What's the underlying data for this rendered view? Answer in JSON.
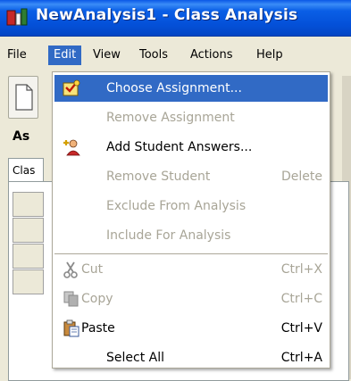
{
  "window": {
    "title": "NewAnalysis1 - Class Analysis"
  },
  "menubar": {
    "items": [
      {
        "label": "File"
      },
      {
        "label": "Edit"
      },
      {
        "label": "View"
      },
      {
        "label": "Tools"
      },
      {
        "label": "Actions"
      },
      {
        "label": "Help"
      }
    ]
  },
  "background": {
    "section_label": "As",
    "tab_label": "Clas"
  },
  "edit_menu": {
    "items": [
      {
        "label": "Choose Assignment...",
        "shortcut": "",
        "enabled": true,
        "highlighted": true,
        "icon": "assignment-icon"
      },
      {
        "label": "Remove Assignment",
        "shortcut": "",
        "enabled": false,
        "icon": ""
      },
      {
        "label": "Add Student Answers...",
        "shortcut": "",
        "enabled": true,
        "icon": "add-student-icon"
      },
      {
        "label": "Remove Student",
        "shortcut": "Delete",
        "enabled": false,
        "icon": ""
      },
      {
        "label": "Exclude From Analysis",
        "shortcut": "",
        "enabled": false,
        "icon": ""
      },
      {
        "label": "Include For Analysis",
        "shortcut": "",
        "enabled": false,
        "icon": ""
      },
      {
        "label": "Cut",
        "shortcut": "Ctrl+X",
        "enabled": false,
        "icon": "scissors-icon"
      },
      {
        "label": "Copy",
        "shortcut": "Ctrl+C",
        "enabled": false,
        "icon": "copy-icon"
      },
      {
        "label": "Paste",
        "shortcut": "Ctrl+V",
        "enabled": true,
        "icon": "paste-icon"
      },
      {
        "label": "Select All",
        "shortcut": "Ctrl+A",
        "enabled": true,
        "icon": ""
      }
    ]
  },
  "colors": {
    "titlebar": "#0a5fe6",
    "highlight": "#316ac5",
    "disabled_text": "#a8a597",
    "menu_bg": "#ffffff",
    "chrome": "#ece9d8"
  }
}
